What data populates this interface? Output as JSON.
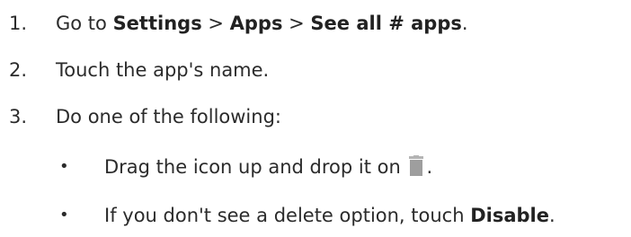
{
  "steps": [
    {
      "number": "1.",
      "parts": {
        "t1": "Go to ",
        "b1": "Settings",
        "t2": " > ",
        "b2": "Apps",
        "t3": " > ",
        "b3": "See all # apps",
        "t4": "."
      }
    },
    {
      "number": "2.",
      "text": "Touch the app's name."
    },
    {
      "number": "3.",
      "text": "Do one of the following:"
    }
  ],
  "bullets": [
    {
      "symbol": "•",
      "before": "Drag the icon up and drop it on ",
      "icon": "trash-icon",
      "after": "."
    },
    {
      "symbol": "•",
      "before": "If you don't see a delete option, touch ",
      "bold": "Disable",
      "after": "."
    }
  ],
  "colors": {
    "text": "#2b2b2b",
    "icon": "#9e9e9e"
  }
}
